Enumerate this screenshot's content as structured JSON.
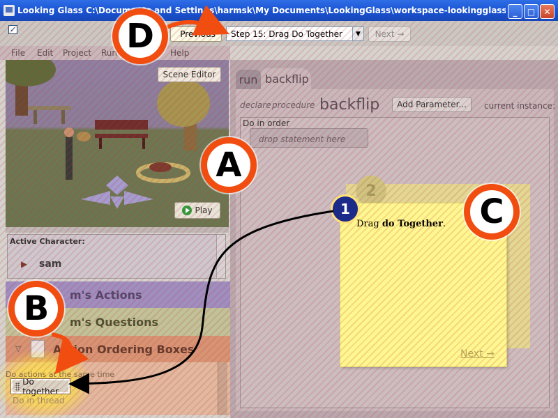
{
  "window": {
    "title": "Looking Glass  C:\\Documents and Settings\\harmsk\\My Documents\\LookingGlass\\workspace-lookingglass\\ide\\sha..."
  },
  "toolbar": {
    "checkbox_mark": "✓",
    "previous_label": "Previous",
    "step_select_value": "Step 15: Drag Do Together",
    "next_label": "Next →"
  },
  "menu": [
    "File",
    "Edit",
    "Project",
    "Run",
    "Help"
  ],
  "scene": {
    "editor_label": "Scene Editor",
    "play_label": "Play"
  },
  "active_character": {
    "title": "Active Character:",
    "name": "sam"
  },
  "sections": {
    "actions": "m's Actions",
    "questions": "m's Questions",
    "ordering": "Action Ordering Boxes",
    "ordering_hint": "Do actions at the same time",
    "do_together": "Do together",
    "do_in_thread": "Do in thread"
  },
  "editor": {
    "tab_run": "run",
    "tab_backflip": "backflip",
    "declare": "declare",
    "procedure": "procedure",
    "method_name": "backflip",
    "add_parameter": "Add Parameter...",
    "current_instance": "current instance:",
    "do_in_order": "Do in order",
    "drop_statement": "drop statement here"
  },
  "tutorial": {
    "badge_back": "2",
    "badge_front": "1",
    "note_prefix": "Drag ",
    "note_bold": "do Together",
    "note_suffix": ".",
    "note_next": "Next →"
  },
  "markers": {
    "a": "A",
    "b": "B",
    "c": "C",
    "d": "D"
  },
  "colors": {
    "marker_ring": "#f14d10",
    "highlight": "#ffe84a",
    "titlebar": "#1a52d1"
  }
}
